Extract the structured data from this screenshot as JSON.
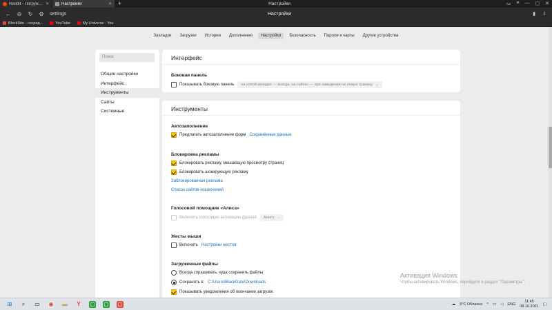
{
  "tabs": [
    {
      "title": "Reddit - Погружайтесь в",
      "favicon": "reddit-icon"
    },
    {
      "title": "Настройки",
      "favicon": "settings-icon"
    }
  ],
  "window_title": "Настройки",
  "address": {
    "url": "settings",
    "center_title": "Настройки"
  },
  "bookmarks": [
    {
      "label": "BlockSite - сосред...",
      "color": "#e04a2f"
    },
    {
      "label": "YouTube",
      "color": "#ff0000"
    },
    {
      "label": "My Universe - You",
      "color": "#ff0000"
    }
  ],
  "topnav": [
    {
      "label": "Закладки",
      "active": false
    },
    {
      "label": "Загрузки",
      "active": false
    },
    {
      "label": "История",
      "active": false
    },
    {
      "label": "Дополнения",
      "active": false
    },
    {
      "label": "Настройки",
      "active": true
    },
    {
      "label": "Безопасность",
      "active": false
    },
    {
      "label": "Пароли и карты",
      "active": false
    },
    {
      "label": "Другие устройства",
      "active": false
    }
  ],
  "sidebar": {
    "search_placeholder": "Поиск",
    "items": [
      {
        "label": "Общие настройки",
        "active": false
      },
      {
        "label": "Интерфейс",
        "active": false
      },
      {
        "label": "Инструменты",
        "active": true
      },
      {
        "label": "Сайты",
        "active": false
      },
      {
        "label": "Системные",
        "active": false
      }
    ]
  },
  "interface_panel": {
    "title": "Интерфейс",
    "side_panel": {
      "heading": "Боковая панель",
      "checkbox_label": "Показывать боковую панель",
      "dropdown_value": "на новой вкладке — всегда, на сайтах — при наведении на левую границу"
    }
  },
  "tools_panel": {
    "title": "Инструменты",
    "autofill": {
      "heading": "Автозаполнение",
      "checkbox_label": "Предлагать автозаполнение форм",
      "link": "Сохранённые данные"
    },
    "adblock": {
      "heading": "Блокировка рекламы",
      "option1": "Блокировать рекламу, мешающую просмотру страниц",
      "option2": "Блокировать шокирующую рекламу",
      "link1": "Заблокированная реклама",
      "link2": "Список сайтов-исключений"
    },
    "alice": {
      "heading": "Голосовой помощник «Алиса»",
      "checkbox_label": "Включить голосовую активацию фразой",
      "dropdown_value": "Алиса"
    },
    "gestures": {
      "heading": "Жесты мыши",
      "checkbox_label": "Включить",
      "link": "Настройки жестов"
    },
    "downloads": {
      "heading": "Загруженные файлы",
      "radio1": "Всегда спрашивать, куда сохранять файлы",
      "radio2_label": "Сохранять в:",
      "radio2_path": "C:\\Users\\BlackGate\\Downloads",
      "checkbox_label": "Показывать уведомления об окончании загрузок"
    }
  },
  "watermark": {
    "line1": "Активация Windows",
    "line2": "Чтобы активировать Windows, перейдите в раздел \"Параметры\"."
  },
  "taskbar": {
    "weather": "5°C Облачно",
    "lang": "ENG",
    "time": "11:45",
    "date": "08.10.2021"
  }
}
